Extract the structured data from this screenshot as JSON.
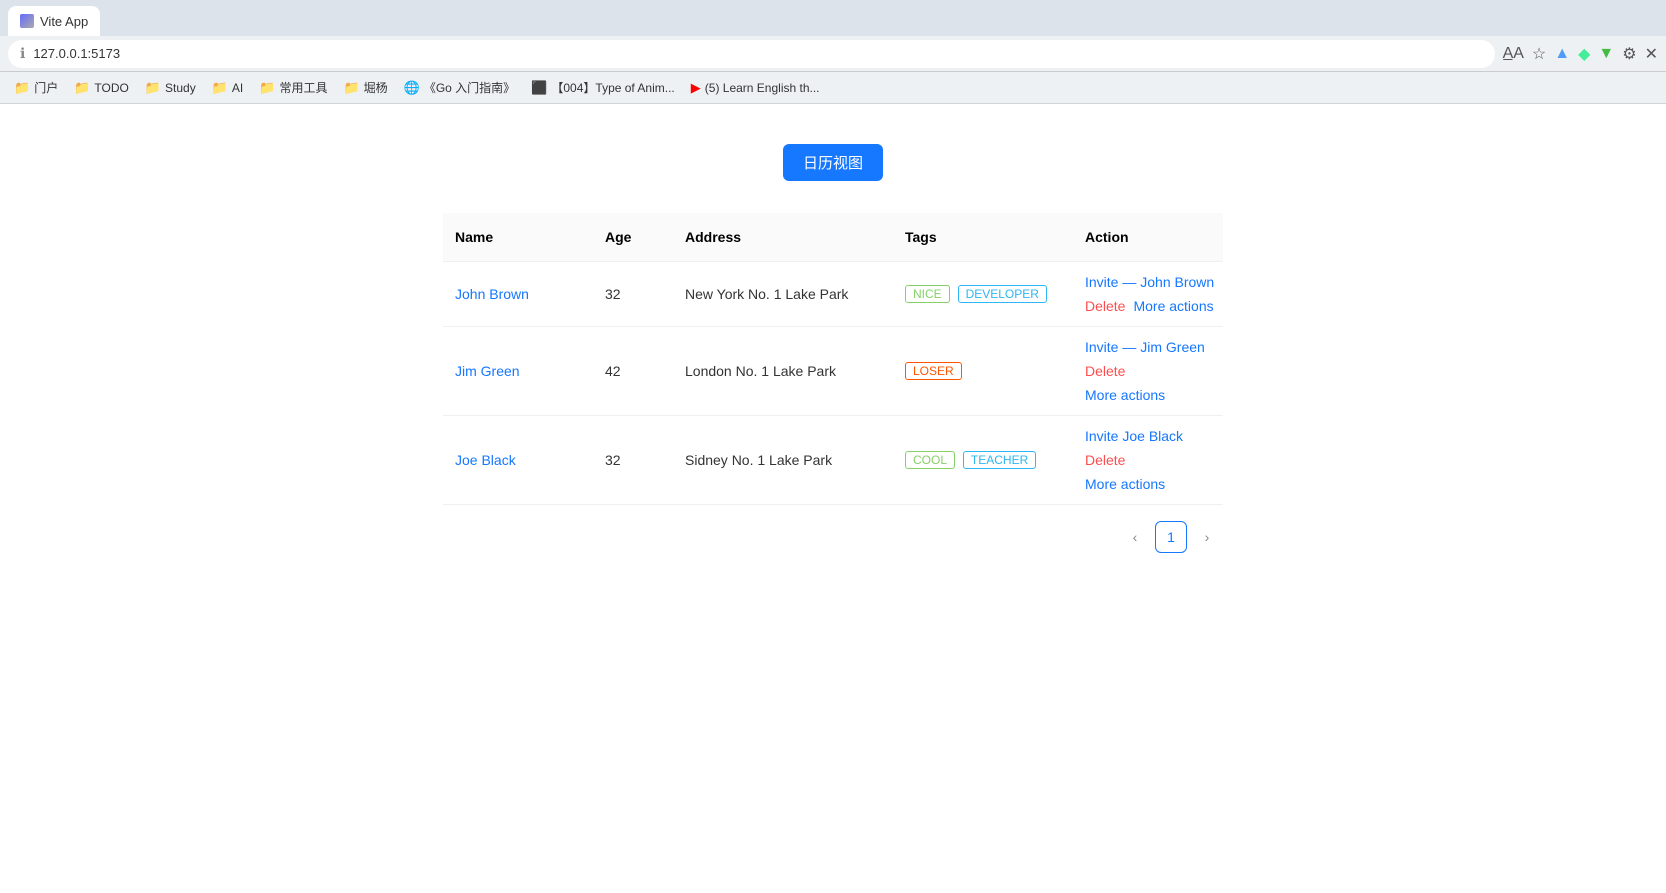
{
  "browser": {
    "url": "127.0.0.1:5173",
    "tab_label": "Vite App"
  },
  "bookmarks": [
    {
      "label": "门户",
      "icon": "folder"
    },
    {
      "label": "TODO",
      "icon": "folder"
    },
    {
      "label": "Study",
      "icon": "folder"
    },
    {
      "label": "AI",
      "icon": "folder"
    },
    {
      "label": "常用工具",
      "icon": "folder"
    },
    {
      "label": "堀杨",
      "icon": "folder"
    },
    {
      "label": "《Go 入门指南》",
      "icon": "page"
    },
    {
      "label": "【004】Type of Anim...",
      "icon": "page"
    },
    {
      "label": "(5) Learn English th...",
      "icon": "page"
    }
  ],
  "calendar_button": "日历视图",
  "table": {
    "headers": [
      "Name",
      "Age",
      "Address",
      "Tags",
      "Action"
    ],
    "rows": [
      {
        "name": "John Brown",
        "age": "32",
        "address": "New York No. 1 Lake Park",
        "tags": [
          {
            "label": "NICE",
            "class": "tag-nice"
          },
          {
            "label": "DEVELOPER",
            "class": "tag-developer"
          }
        ],
        "actions": {
          "invite": "Invite — John Brown",
          "delete": "Delete",
          "more": "More actions"
        }
      },
      {
        "name": "Jim Green",
        "age": "42",
        "address": "London No. 1 Lake Park",
        "tags": [
          {
            "label": "LOSER",
            "class": "tag-loser"
          }
        ],
        "actions": {
          "invite": "Invite — Jim Green",
          "delete": "Delete",
          "more": "More actions"
        }
      },
      {
        "name": "Joe Black",
        "age": "32",
        "address": "Sidney No. 1 Lake Park",
        "tags": [
          {
            "label": "COOL",
            "class": "tag-cool"
          },
          {
            "label": "TEACHER",
            "class": "tag-teacher"
          }
        ],
        "actions": {
          "invite": "Invite Joe Black",
          "delete": "Delete",
          "more": "More actions"
        }
      }
    ]
  },
  "pagination": {
    "prev_label": "‹",
    "next_label": "›",
    "current_page": "1"
  }
}
